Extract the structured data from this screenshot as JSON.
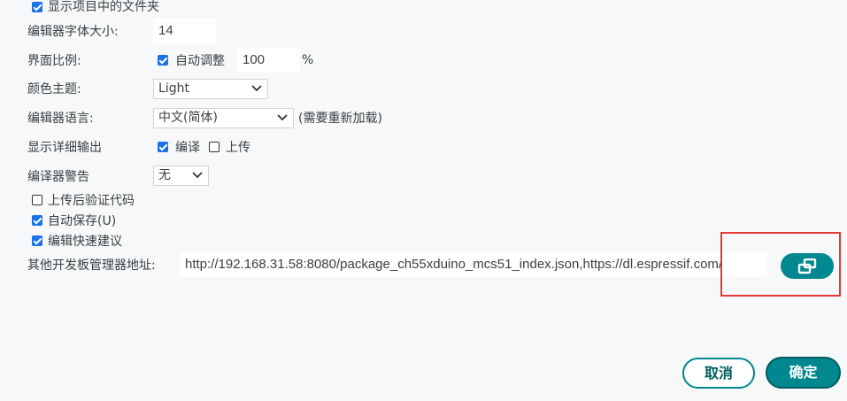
{
  "prefs": {
    "show_sketch_folder": {
      "label": "显示项目中的文件夹",
      "checked": true
    },
    "editor_font_size": {
      "label": "编辑器字体大小:",
      "value": "14"
    },
    "interface_scale": {
      "label": "界面比例:",
      "auto_label": "自动调整",
      "auto_checked": true,
      "value": "100",
      "unit": "%"
    },
    "theme": {
      "label": "颜色主题:",
      "selected": "Light"
    },
    "language": {
      "label": "编辑器语言:",
      "selected": "中文(简体)",
      "note": "(需要重新加载)"
    },
    "verbose_output": {
      "label": "显示详细输出",
      "compile_label": "编译",
      "compile_checked": true,
      "upload_label": "上传",
      "upload_checked": false
    },
    "compiler_warnings": {
      "label": "编译器警告",
      "selected": "无"
    },
    "verify_after_upload": {
      "label": "上传后验证代码",
      "checked": false
    },
    "auto_save": {
      "label": "自动保存(U)",
      "checked": true
    },
    "quick_suggestions": {
      "label": "编辑快速建议",
      "checked": true
    },
    "board_urls": {
      "label": "其他开发板管理器地址:",
      "value": "http://192.168.31.58:8080/package_ch55xduino_mcs51_index.json,https://dl.espressif.com/"
    }
  },
  "buttons": {
    "cancel": "取消",
    "ok": "确定"
  },
  "colors": {
    "accent": "#00878f",
    "highlight": "#e53935",
    "checkbox": "#1a73e8"
  }
}
